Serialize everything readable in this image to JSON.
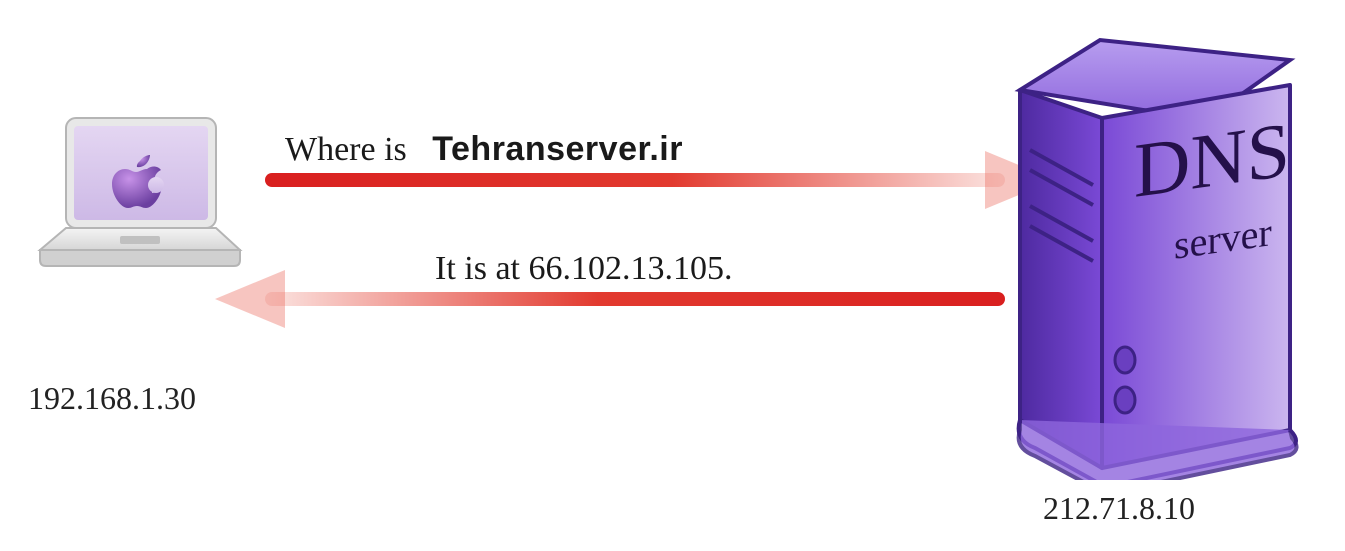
{
  "client": {
    "ip": "192.168.1.30"
  },
  "server": {
    "label_top": "DNS",
    "label_sub": "server",
    "ip": "212.71.8.10"
  },
  "query": {
    "prefix": "Where is",
    "domain": "Tehranserver.ir"
  },
  "response": {
    "text": "It is at 66.102.13.105."
  }
}
